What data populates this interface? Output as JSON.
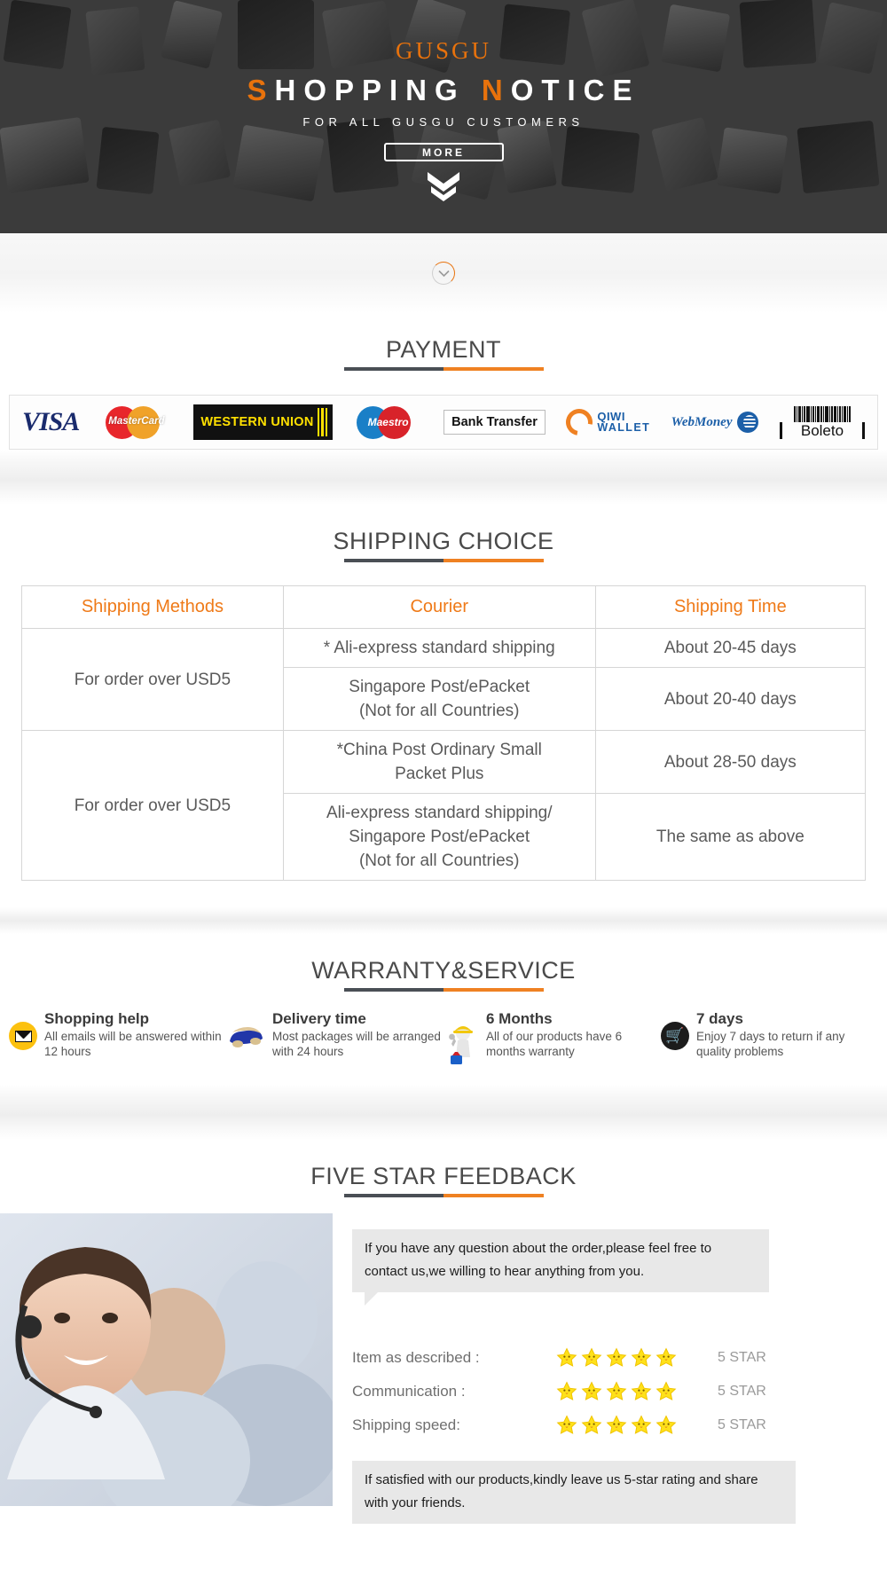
{
  "banner": {
    "brand": "GUSGU",
    "title_parts": [
      {
        "text": "S",
        "accent": true
      },
      {
        "text": "HOPPING ",
        "accent": false
      },
      {
        "text": "N",
        "accent": true
      },
      {
        "text": "OTICE",
        "accent": false
      }
    ],
    "title_plain": "SHOPPING NOTICE",
    "subtitle": "FOR ALL GUSGU CUSTOMERS",
    "more_label": "MORE",
    "chevron_icon": "double-chevron-down-icon",
    "scroll_icon": "circle-chevron-down-icon",
    "bg_color": "#3b3b3b",
    "accent_color": "#e8720c"
  },
  "payment": {
    "title": "PAYMENT",
    "methods": [
      {
        "name": "visa",
        "label": "VISA"
      },
      {
        "name": "mastercard",
        "label": "MasterCard"
      },
      {
        "name": "western-union",
        "line1": "WESTERN",
        "line2": "UNION"
      },
      {
        "name": "maestro",
        "label": "Maestro"
      },
      {
        "name": "bank-transfer",
        "label": "Bank Transfer"
      },
      {
        "name": "qiwi-wallet",
        "line1": "QIWI",
        "line2": "WALLET"
      },
      {
        "name": "webmoney",
        "label": "WebMoney"
      },
      {
        "name": "boleto",
        "label": "Boleto"
      }
    ]
  },
  "shipping": {
    "title": "SHIPPING CHOICE",
    "headers": [
      "Shipping Methods",
      "Courier",
      "Shipping Time"
    ],
    "groups": [
      {
        "method": "For order over USD5",
        "rows": [
          {
            "courier": "* Ali-express standard shipping",
            "time": "About 20-45 days"
          },
          {
            "courier": "Singapore Post/ePacket\n(Not for all Countries)",
            "time": "About 20-40 days"
          }
        ]
      },
      {
        "method": "For order over USD5",
        "rows": [
          {
            "courier": "*China Post Ordinary Small\nPacket Plus",
            "time": "About 28-50 days"
          },
          {
            "courier": "Ali-express standard shipping/\nSingapore Post/ePacket\n(Not for all Countries)",
            "time": "The same as above"
          }
        ]
      }
    ]
  },
  "warranty": {
    "title": "WARRANTY&SERVICE",
    "items": [
      {
        "icon": "mail-icon",
        "heading": "Shopping help",
        "body": "All emails will be answered within 12 hours"
      },
      {
        "icon": "delivery-truck-icon",
        "heading": "Delivery time",
        "body": "Most packages will be arranged with 24 hours"
      },
      {
        "icon": "worker-wrench-icon",
        "heading": "6 Months",
        "body": "All of our products have 6 months warranty"
      },
      {
        "icon": "shopping-cart-icon",
        "heading": "7 days",
        "body": "Enjoy 7 days to return if any quality problems"
      }
    ]
  },
  "feedback": {
    "title": "FIVE STAR FEEDBACK",
    "photo_alt": "customer-service-agents-photo",
    "bubble": "If you have any question about the order,please feel free to contact us,we willing to hear anything from you.",
    "ratings": [
      {
        "label": "Item as described :",
        "stars": 5,
        "value": "5 STAR"
      },
      {
        "label": "Communication :",
        "stars": 5,
        "value": "5 STAR"
      },
      {
        "label": "Shipping speed:",
        "stars": 5,
        "value": "5 STAR"
      }
    ],
    "closing": "If satisfied with our products,kindly leave us 5-star rating and share with your friends."
  },
  "colors": {
    "accent_orange": "#ef8122",
    "rule_dark": "#4a4f55",
    "header_orange": "#ef7a18",
    "text_gray": "#5a5a5a"
  }
}
